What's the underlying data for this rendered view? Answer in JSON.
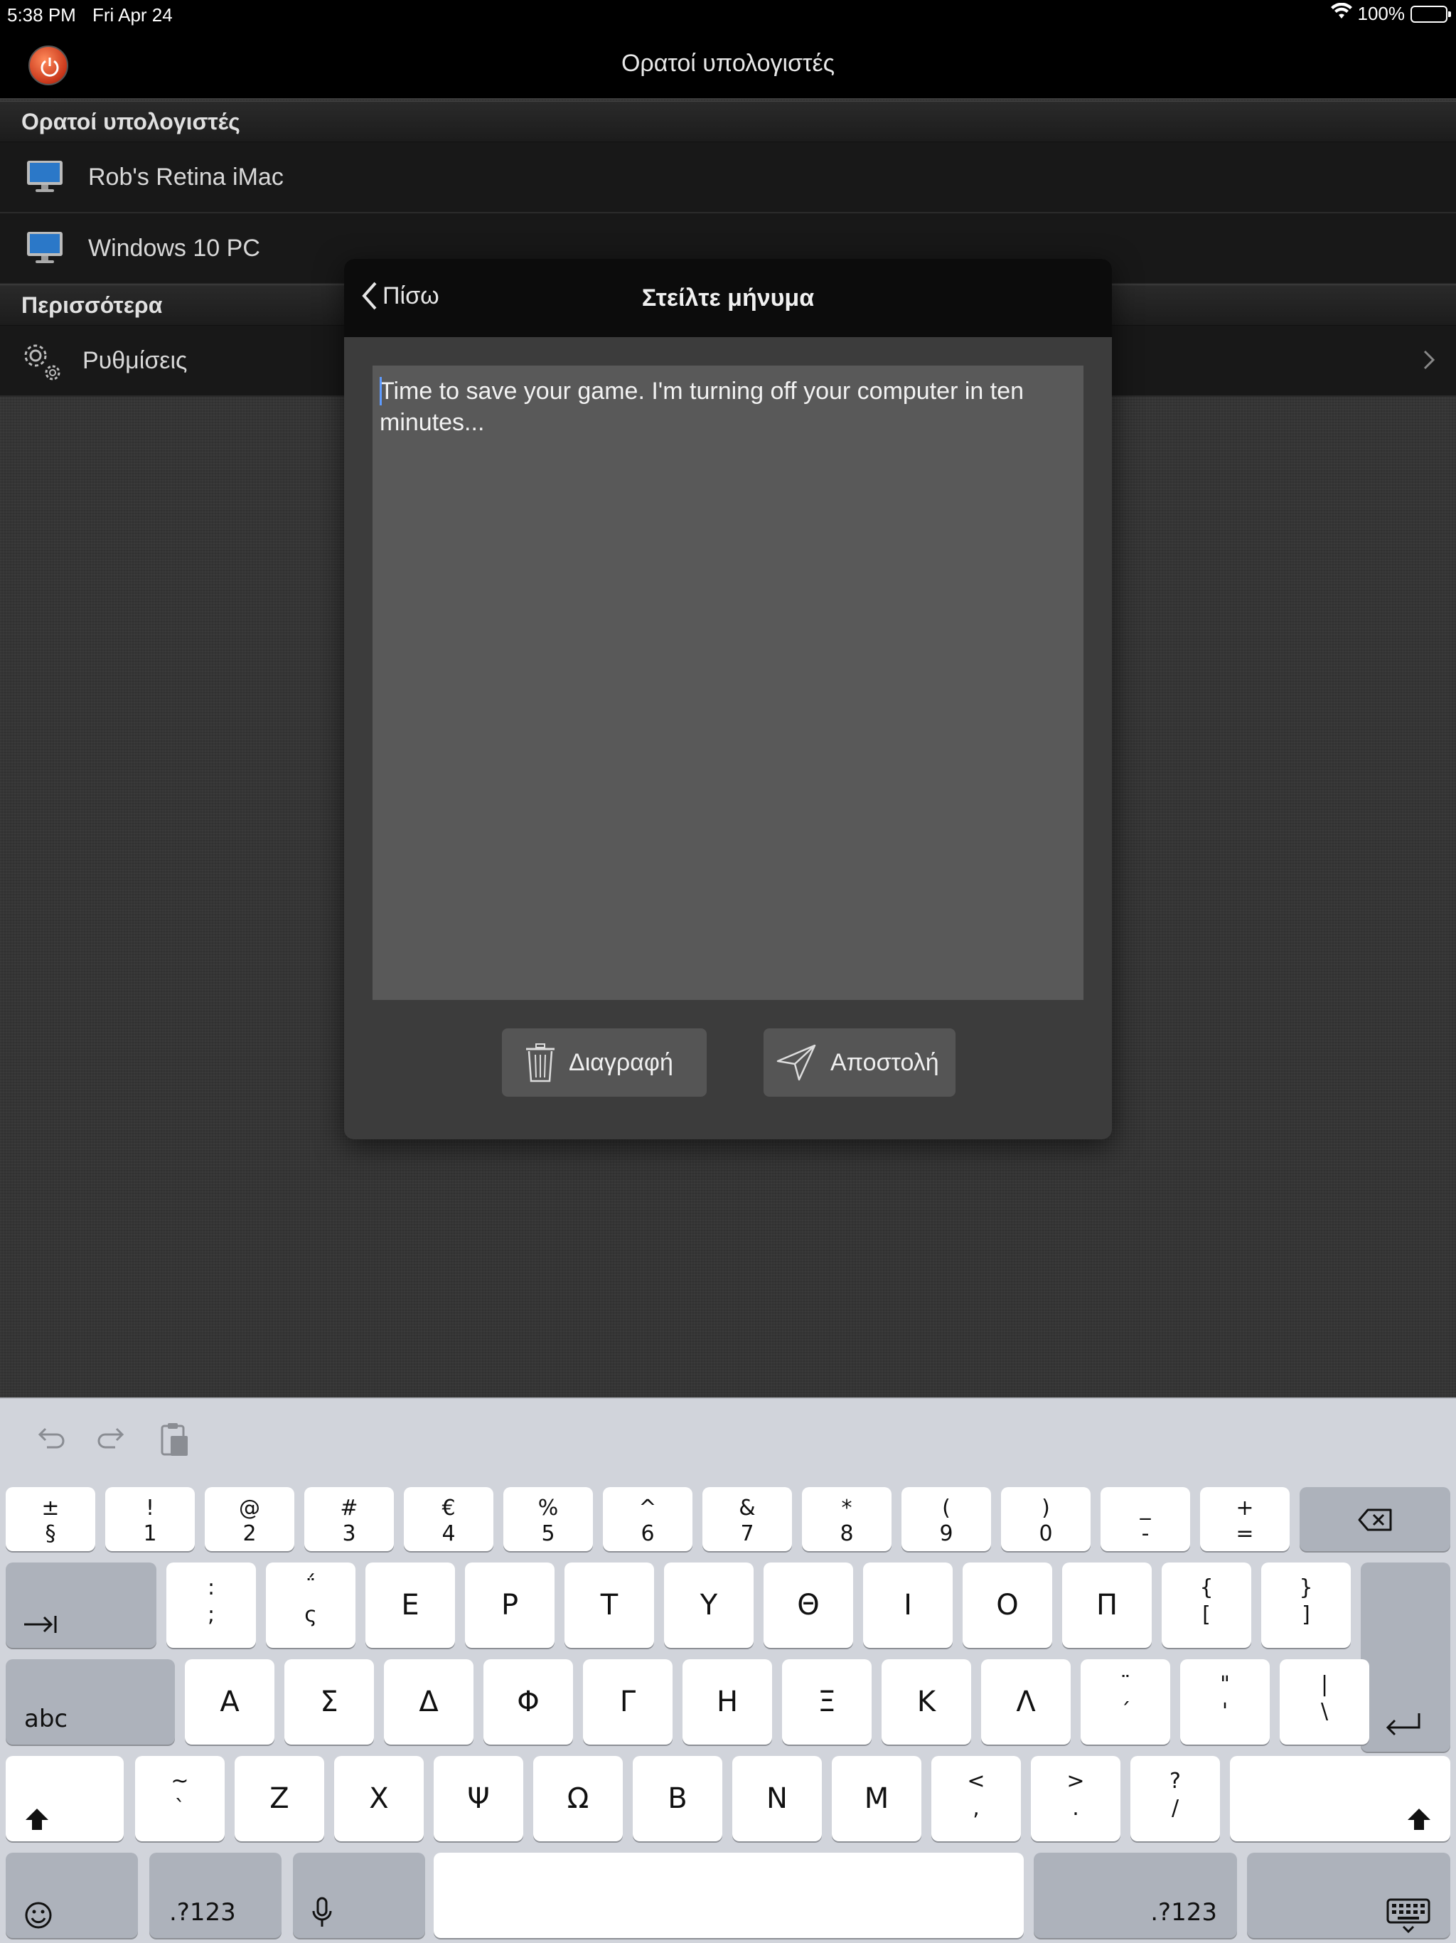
{
  "status": {
    "time": "5:38 PM",
    "date": "Fri Apr 24",
    "battery": "100%"
  },
  "nav": {
    "title": "Ορατοί υπολογιστές"
  },
  "sections": {
    "visible_header": "Ορατοί υπολογιστές",
    "computers": [
      {
        "label": "Rob's Retina iMac"
      },
      {
        "label": "Windows 10 PC"
      }
    ],
    "more_header": "Περισσότερα",
    "settings_label": "Ρυθμίσεις"
  },
  "modal": {
    "back_label": "Πίσω",
    "title": "Στείλτε μήνυμα",
    "message": "Time to save your game. I'm turning off your computer in ten minutes...",
    "delete_label": "Διαγραφή",
    "send_label": "Αποστολή"
  },
  "keyboard": {
    "row1": [
      {
        "top": "±",
        "bottom": "§"
      },
      {
        "top": "!",
        "bottom": "1"
      },
      {
        "top": "@",
        "bottom": "2"
      },
      {
        "top": "#",
        "bottom": "3"
      },
      {
        "top": "€",
        "bottom": "4"
      },
      {
        "top": "%",
        "bottom": "5"
      },
      {
        "top": "^",
        "bottom": "6"
      },
      {
        "top": "&",
        "bottom": "7"
      },
      {
        "top": "*",
        "bottom": "8"
      },
      {
        "top": "(",
        "bottom": "9"
      },
      {
        "top": ")",
        "bottom": "0"
      },
      {
        "top": "_",
        "bottom": "-"
      },
      {
        "top": "+",
        "bottom": "="
      }
    ],
    "row2_dual": [
      {
        "top": ":",
        "bottom": ";"
      },
      {
        "top": "΅",
        "bottom": "ς"
      }
    ],
    "row2": [
      "Ε",
      "Ρ",
      "Τ",
      "Υ",
      "Θ",
      "Ι",
      "Ο",
      "Π"
    ],
    "row2_tail": [
      {
        "top": "{",
        "bottom": "["
      },
      {
        "top": "}",
        "bottom": "]"
      }
    ],
    "row3": [
      "Α",
      "Σ",
      "Δ",
      "Φ",
      "Γ",
      "Η",
      "Ξ",
      "Κ",
      "Λ"
    ],
    "row3_tail": [
      {
        "top": "¨",
        "bottom": "´"
      },
      {
        "top": "\"",
        "bottom": "'"
      },
      {
        "top": "|",
        "bottom": "\\"
      }
    ],
    "row4_head": [
      {
        "top": "~",
        "bottom": "`"
      }
    ],
    "row4": [
      "Ζ",
      "Χ",
      "Ψ",
      "Ω",
      "Β",
      "Ν",
      "Μ"
    ],
    "row4_tail": [
      {
        "top": "<",
        "bottom": ","
      },
      {
        "top": ">",
        "bottom": "."
      },
      {
        "top": "?",
        "bottom": "/"
      }
    ],
    "abc_label": "abc",
    "numbers_label": ".?123"
  }
}
